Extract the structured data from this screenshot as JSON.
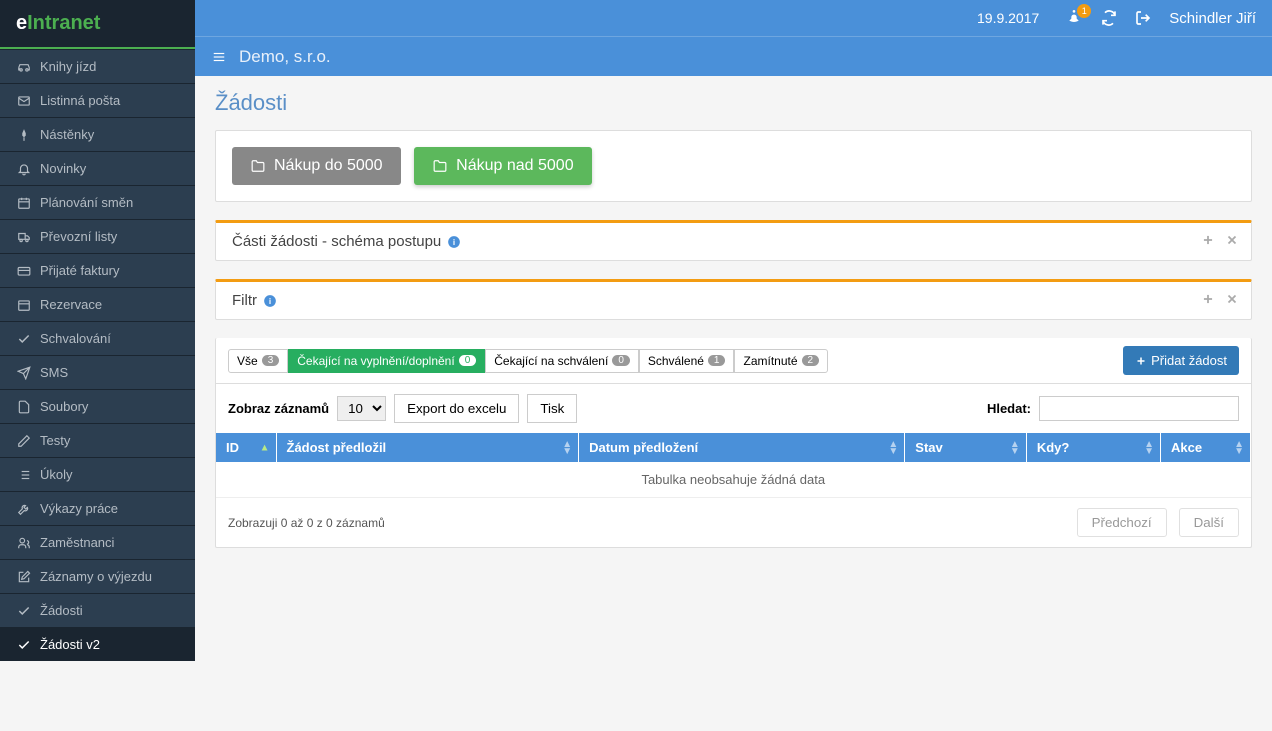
{
  "logo": {
    "prefix": "e",
    "text": "Intranet"
  },
  "topbar": {
    "date": "19.9.2017",
    "notification_badge": "1",
    "username": "Schindler Jiří"
  },
  "subbar": {
    "company": "Demo, s.r.o."
  },
  "page": {
    "title": "Žádosti"
  },
  "sidebar": {
    "items": [
      {
        "label": "Knihy jízd",
        "icon": "car"
      },
      {
        "label": "Listinná pošta",
        "icon": "envelope"
      },
      {
        "label": "Nástěnky",
        "icon": "pin"
      },
      {
        "label": "Novinky",
        "icon": "bell"
      },
      {
        "label": "Plánování směn",
        "icon": "calendar"
      },
      {
        "label": "Převozní listy",
        "icon": "truck"
      },
      {
        "label": "Přijaté faktury",
        "icon": "creditcard"
      },
      {
        "label": "Rezervace",
        "icon": "calendar2"
      },
      {
        "label": "Schvalování",
        "icon": "check"
      },
      {
        "label": "SMS",
        "icon": "send"
      },
      {
        "label": "Soubory",
        "icon": "file"
      },
      {
        "label": "Testy",
        "icon": "pencil"
      },
      {
        "label": "Úkoly",
        "icon": "list"
      },
      {
        "label": "Výkazy práce",
        "icon": "wrench"
      },
      {
        "label": "Zaměstnanci",
        "icon": "users"
      },
      {
        "label": "Záznamy o výjezdu",
        "icon": "edit"
      },
      {
        "label": "Žádosti",
        "icon": "check"
      },
      {
        "label": "Žádosti v2",
        "icon": "check",
        "active": true
      }
    ]
  },
  "folders": {
    "gray": "Nákup do 5000",
    "green": "Nákup nad 5000"
  },
  "panel1": {
    "title": "Části žádosti - schéma postupu"
  },
  "panel2": {
    "title": "Filtr"
  },
  "tabs": {
    "all": {
      "label": "Vše",
      "count": "3"
    },
    "pending_fill": {
      "label": "Čekající na vyplnění/doplnění",
      "count": "0"
    },
    "pending_approve": {
      "label": "Čekající na schválení",
      "count": "0"
    },
    "approved": {
      "label": "Schválené",
      "count": "1"
    },
    "rejected": {
      "label": "Zamítnuté",
      "count": "2"
    }
  },
  "buttons": {
    "add": "Přidat žádost",
    "export": "Export do excelu",
    "print": "Tisk"
  },
  "toolbar": {
    "show_records": "Zobraz záznamů",
    "page_size": "10",
    "search_label": "Hledat:"
  },
  "table": {
    "columns": {
      "id": "ID",
      "submitted_by": "Žádost předložil",
      "date": "Datum předložení",
      "status": "Stav",
      "when": "Kdy?",
      "action": "Akce"
    },
    "empty": "Tabulka neobsahuje žádná data",
    "info": "Zobrazuji 0 až 0 z 0 záznamů",
    "prev": "Předchozí",
    "next": "Další"
  }
}
